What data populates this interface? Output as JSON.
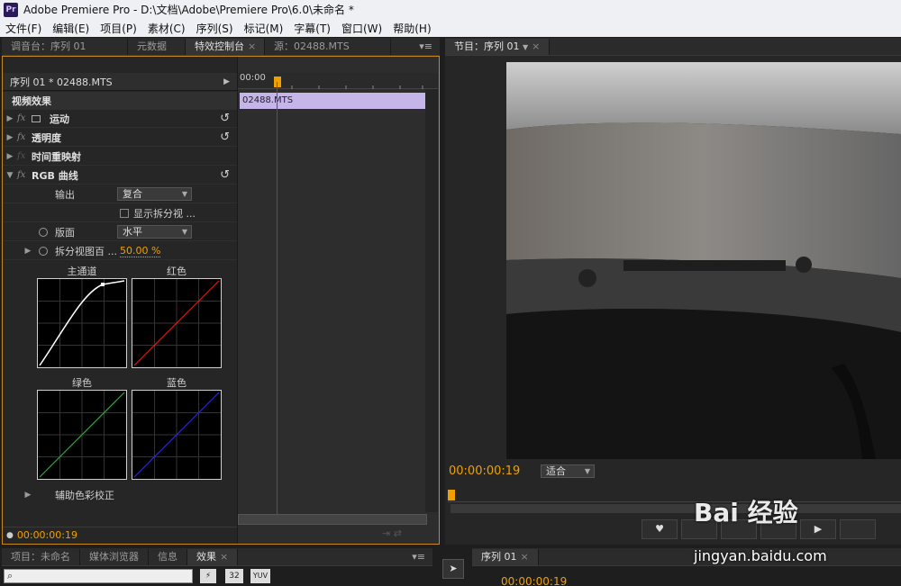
{
  "window": {
    "title": "Adobe Premiere Pro - D:\\文档\\Adobe\\Premiere Pro\\6.0\\未命名 *",
    "logo": "Pr"
  },
  "menu": [
    "文件(F)",
    "编辑(E)",
    "项目(P)",
    "素材(C)",
    "序列(S)",
    "标记(M)",
    "字幕(T)",
    "窗口(W)",
    "帮助(H)"
  ],
  "left_tabs": [
    {
      "label": "调音台：序列 01",
      "active": false
    },
    {
      "label": "元数据",
      "active": false
    },
    {
      "label": "特效控制台",
      "active": true
    },
    {
      "label": "源：02488.MTS",
      "active": false
    }
  ],
  "effect_controls": {
    "clip_header": "序列 01 * 02488.MTS",
    "clip_bar": "02488.MTS",
    "timeline_start": "00:00",
    "video_effects_label": "视频效果",
    "effects": [
      {
        "name": "运动"
      },
      {
        "name": "透明度"
      },
      {
        "name": "时间重映射"
      },
      {
        "name": "RGB 曲线"
      }
    ],
    "output_label": "输出",
    "output_value": "复合",
    "show_split_label": "显示拆分视 ...",
    "layout_label": "版面",
    "layout_value": "水平",
    "split_percent_label": "拆分视图百 ...",
    "split_percent_value": "50.00 %",
    "curves": [
      "主通道",
      "红色",
      "绿色",
      "蓝色"
    ],
    "aux_label": "辅助色彩校正",
    "timecode": "00:00:00:19"
  },
  "program": {
    "tab_label": "节目：序列 01",
    "timecode": "00:00:00:19",
    "fit_label": "适合"
  },
  "bottom_left_tabs": [
    "项目：未命名",
    "媒体浏览器",
    "信息",
    "效果"
  ],
  "bottom_search_placeholder": "",
  "bottom_badges": [
    "32",
    "YUV"
  ],
  "bottom_right": {
    "tab_label": "序列 01",
    "timecode": "00:00:00:19"
  },
  "watermark": {
    "text": "Bai 经验",
    "url": "jingyan.baidu.com"
  },
  "colors": {
    "accent": "#f0a000",
    "panel": "#262626",
    "border_active": "#c6891e",
    "clip": "#c6b5e8"
  }
}
